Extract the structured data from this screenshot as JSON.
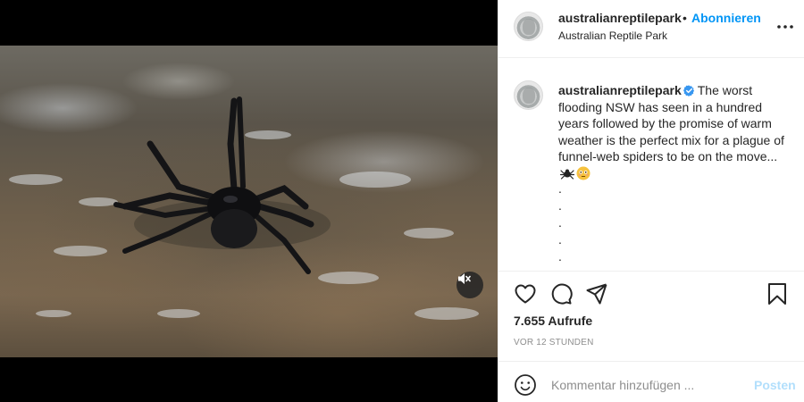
{
  "post": {
    "username": "australianreptilepark",
    "dot_separator": "•",
    "follow_label": "Abonnieren",
    "location": "Australian Reptile Park",
    "caption": {
      "username": "australianreptilepark",
      "text": "The worst flooding NSW has seen in a hundred years followed by the promise of warm weather is the perfect mix for a plague of funnel-web spiders to be on the move...",
      "emojis": [
        "spider-emoji",
        "flushed-face-emoji"
      ],
      "trailing_dots": [
        ".",
        ".",
        ".",
        ".",
        "."
      ]
    },
    "views_label": "7.655 Aufrufe",
    "timestamp": "VOR 12 STUNDEN",
    "comment": {
      "placeholder": "Kommentar hinzufügen ...",
      "post_label": "Posten"
    }
  },
  "icons": {
    "more": "more-options-icon",
    "verified": "verified-badge-icon",
    "like": "heart-icon",
    "comment": "comment-icon",
    "share": "share-icon",
    "save": "bookmark-icon",
    "emoji": "smiley-icon",
    "mute": "muted-speaker-icon"
  },
  "colors": {
    "link_blue": "#0095f6",
    "post_disabled": "#b2dffc",
    "text": "#262626",
    "muted": "#8e8e8e",
    "border": "#efefef"
  }
}
